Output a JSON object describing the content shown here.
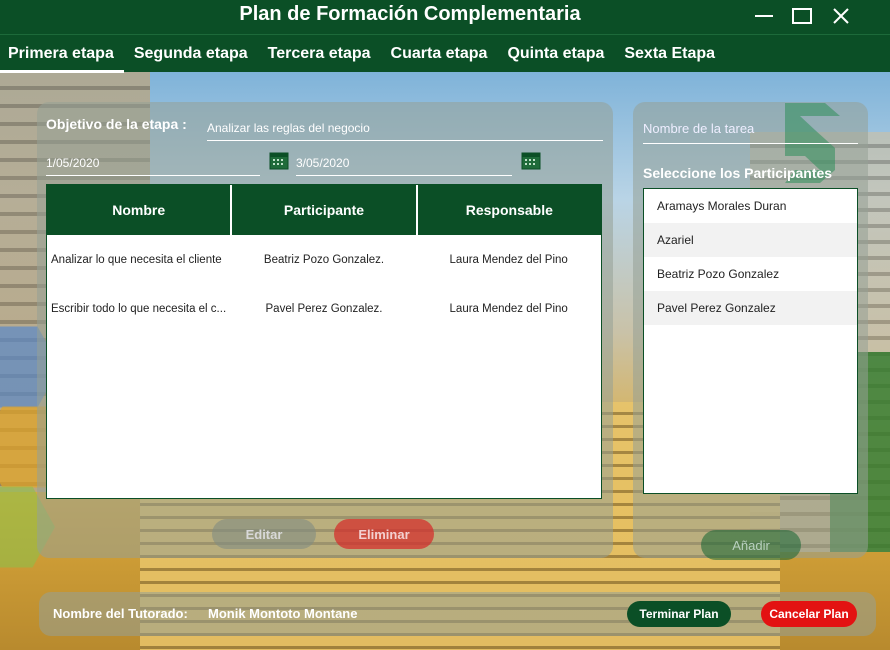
{
  "window": {
    "title": "Plan de Formación Complementaria"
  },
  "tabs": [
    {
      "label": "Primera etapa",
      "active": true
    },
    {
      "label": "Segunda etapa",
      "active": false
    },
    {
      "label": "Tercera etapa",
      "active": false
    },
    {
      "label": "Cuarta etapa",
      "active": false
    },
    {
      "label": "Quinta etapa",
      "active": false
    },
    {
      "label": "Sexta Etapa",
      "active": false
    }
  ],
  "stage": {
    "objective_label": "Objetivo de la etapa :",
    "objective_value": "Analizar las reglas del negocio",
    "start_date": "1/05/2020",
    "end_date": "3/05/2020"
  },
  "table": {
    "headers": [
      "Nombre",
      "Participante",
      "Responsable"
    ],
    "rows": [
      [
        "Analizar lo que necesita el cliente",
        "Beatriz Pozo Gonzalez.",
        "Laura Mendez del Pino"
      ],
      [
        "Escribir todo lo que necesita el c...",
        "Pavel Perez Gonzalez.",
        "Laura Mendez del Pino"
      ]
    ]
  },
  "actions": {
    "edit_label": "Editar",
    "delete_label": "Eliminar",
    "add_label": "Añadir"
  },
  "task": {
    "name_placeholder": "Nombre de la tarea",
    "participants_label": "Seleccione los Participantes",
    "participants": [
      "Aramays Morales Duran",
      "Azariel",
      "Beatriz Pozo Gonzalez",
      "Pavel Perez Gonzalez"
    ]
  },
  "footer": {
    "tutored_label": "Nombre del Tutorado:",
    "tutored_name": "Monik Montoto Montane",
    "finish_label": "Terminar Plan",
    "cancel_label": "Cancelar Plan"
  },
  "colors": {
    "primary": "#0b4f26",
    "danger": "#e31212"
  },
  "icons": [
    "minimize-icon",
    "maximize-icon",
    "close-icon",
    "calendar-icon"
  ]
}
